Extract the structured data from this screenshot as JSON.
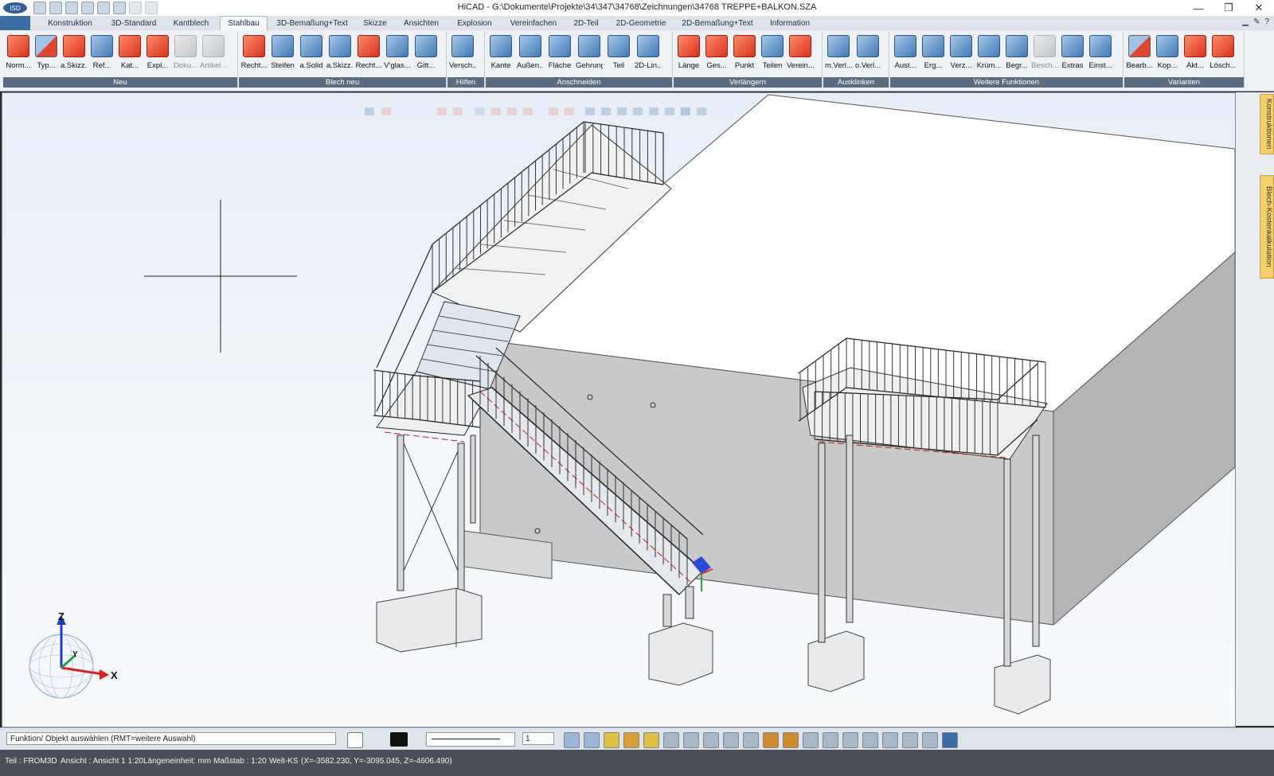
{
  "window": {
    "title": "HiCAD - G:\\Dokumente\\Projekte\\34\\347\\34768\\Zeichnungen\\34768 TREPPE+BALKON.SZA",
    "minimize": "—",
    "restore": "❐",
    "close": "✕"
  },
  "tabs": [
    {
      "label": "Konstruktion"
    },
    {
      "label": "3D-Standard"
    },
    {
      "label": "Kantblech"
    },
    {
      "label": "Stahlbau"
    },
    {
      "label": "3D-Bemaßung+Text"
    },
    {
      "label": "Skizze"
    },
    {
      "label": "Ansichten"
    },
    {
      "label": "Explosion"
    },
    {
      "label": "Vereinfachen"
    },
    {
      "label": "2D-Teil"
    },
    {
      "label": "2D-Geometrie"
    },
    {
      "label": "2D-Bemaßung+Text"
    },
    {
      "label": "Information"
    }
  ],
  "active_tab": "Stahlbau",
  "ribbon": {
    "groups": [
      {
        "label": "Neu",
        "buttons": [
          "Norm...",
          "Typ...",
          "a.Skizz...",
          "Ref...",
          "Kat...",
          "Expl...",
          "Doku...",
          "Artikel..."
        ]
      },
      {
        "label": "Blech neu",
        "buttons": [
          "Recht...",
          "Steifen",
          "a.Solid",
          "a.Skizz...",
          "Recht...",
          "V'glas...",
          "Gitt..."
        ]
      },
      {
        "label": "Hilfen",
        "buttons": [
          "Versch..."
        ]
      },
      {
        "label": "Anschneiden",
        "buttons": [
          "Kante",
          "Außen...",
          "Fläche",
          "Gehrung",
          "Teil",
          "2D-Lin..."
        ]
      },
      {
        "label": "Verlängern",
        "buttons": [
          "Länge",
          "Ges...",
          "Punkt",
          "Teilen",
          "Verein..."
        ]
      },
      {
        "label": "Ausklinken",
        "buttons": [
          "m.Verl...",
          "o.Verl..."
        ]
      },
      {
        "label": "Weitere Funktionen",
        "buttons": [
          "Aust...",
          "Erg...",
          "Verz...",
          "Krüm...",
          "Begr...",
          "Besch...",
          "Extras",
          "Einst..."
        ]
      },
      {
        "label": "Varianten",
        "buttons": [
          "Bearb...",
          "Kop...",
          "Akt...",
          "Lösch..."
        ]
      }
    ]
  },
  "side_tabs": [
    "Konstruktionen",
    "Blech-Kostenkalkulation"
  ],
  "axes": {
    "z": "Z",
    "y": "Y",
    "x": "X"
  },
  "command_line": "Funktion/ Objekt auswählen (RMT=weitere Auswahl)",
  "line_width_value": "1",
  "status": {
    "part": "Teil : FROM3D",
    "view": "Ansicht : Ansicht 1 1:20",
    "unit": "Längeneinheit: mm",
    "scale": "Maßstab : 1:20",
    "cs": "Welt-KS",
    "coords": "(X=-3582.230, Y=-3095.045, Z=-4606.490)"
  }
}
